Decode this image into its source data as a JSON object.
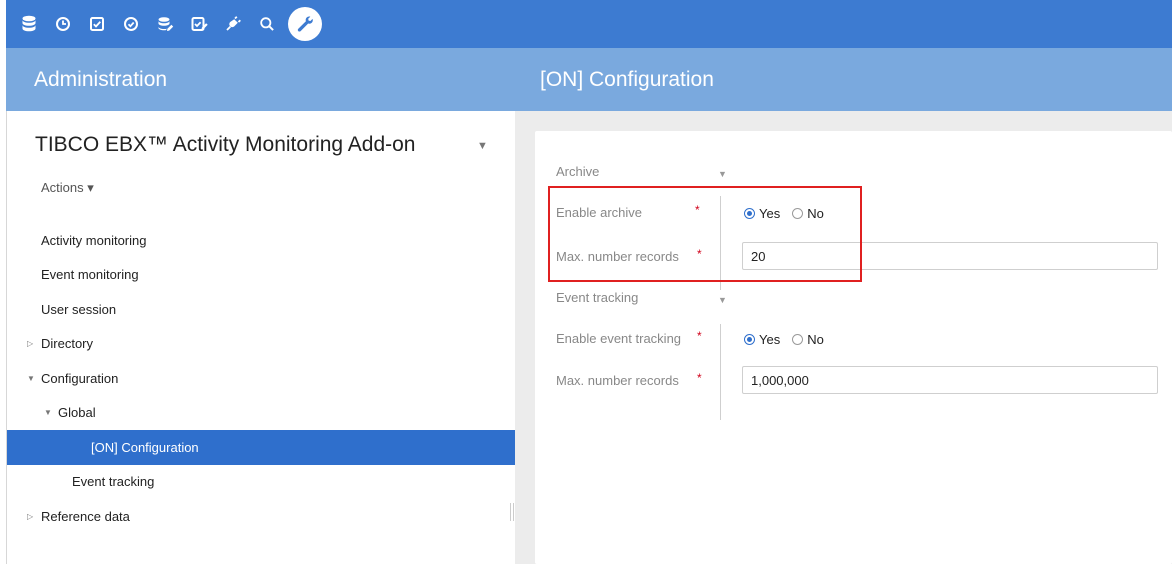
{
  "toolbar": {
    "icons": [
      "database-icon",
      "clock-icon",
      "checkbox-icon",
      "gauge-icon",
      "data-edit-icon",
      "task-check-icon",
      "plug-icon",
      "search-icon",
      "wrench-icon"
    ]
  },
  "header": {
    "left_title": "Administration",
    "right_title": "[ON] Configuration"
  },
  "sidebar": {
    "app_title": "TIBCO EBX™ Activity Monitoring Add-on",
    "actions_label": "Actions ▾",
    "items": [
      {
        "label": "Activity monitoring"
      },
      {
        "label": "Event monitoring"
      },
      {
        "label": "User session"
      },
      {
        "label": "Directory"
      },
      {
        "label": "Configuration"
      },
      {
        "label": "Global"
      },
      {
        "label": "[ON] Configuration"
      },
      {
        "label": "Event tracking"
      },
      {
        "label": "Reference data"
      }
    ]
  },
  "form": {
    "archive": {
      "section_label": "Archive",
      "enable_label": "Enable archive",
      "enable_options": [
        "Yes",
        "No"
      ],
      "enable_value": "Yes",
      "max_label": "Max. number records",
      "max_value": "20"
    },
    "event_tracking": {
      "section_label": "Event tracking",
      "enable_label": "Enable event tracking",
      "enable_options": [
        "Yes",
        "No"
      ],
      "enable_value": "Yes",
      "max_label": "Max. number records",
      "max_value": "1,000,000"
    },
    "required_marker": "*"
  },
  "colors": {
    "toolbar": "#3d7bd1",
    "header": "#7aa9de",
    "selected": "#2f6fcc",
    "highlight": "#e02020",
    "required": "#d0021b"
  }
}
